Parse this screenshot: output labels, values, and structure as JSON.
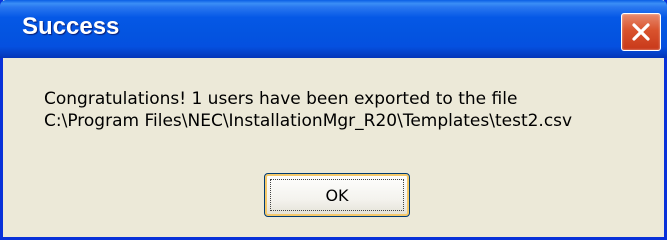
{
  "window": {
    "title": "Success",
    "close_icon": "close-icon"
  },
  "message": {
    "line1": "Congratulations! 1 users have been exported to the file",
    "line2": "C:\\Program Files\\NEC\\InstallationMgr_R20\\Templates\\test2.csv"
  },
  "buttons": {
    "ok_label": "OK"
  },
  "colors": {
    "titlebar": "#0558e6",
    "frame": "#0831d9",
    "dialog_bg": "#ece9d8",
    "close_button": "#d9532d"
  }
}
